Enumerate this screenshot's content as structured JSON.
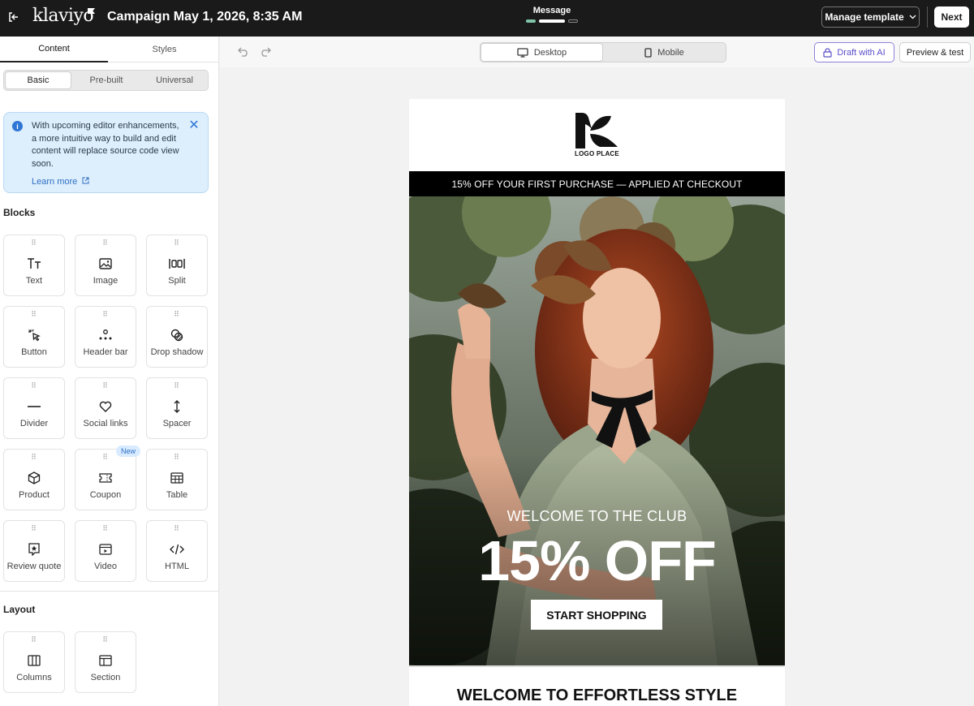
{
  "header": {
    "brand": "klaviyo",
    "campaign_title": "Campaign May 1, 2026, 8:35 AM",
    "step_label": "Message",
    "manage_template_label": "Manage template",
    "next_label": "Next"
  },
  "sidebar": {
    "tabs": [
      "Content",
      "Styles"
    ],
    "segments": [
      "Basic",
      "Pre-built",
      "Universal"
    ],
    "notice": {
      "text": "With upcoming editor enhancements, a more intuitive way to build and edit content will replace source code view soon.",
      "link": "Learn more"
    },
    "blocks_heading": "Blocks",
    "blocks": [
      {
        "label": "Text",
        "icon": "text-icon"
      },
      {
        "label": "Image",
        "icon": "image-icon"
      },
      {
        "label": "Split",
        "icon": "split-icon"
      },
      {
        "label": "Button",
        "icon": "button-cursor-icon"
      },
      {
        "label": "Header bar",
        "icon": "header-bar-icon"
      },
      {
        "label": "Drop shadow",
        "icon": "drop-shadow-icon"
      },
      {
        "label": "Divider",
        "icon": "divider-icon"
      },
      {
        "label": "Social links",
        "icon": "heart-icon"
      },
      {
        "label": "Spacer",
        "icon": "spacer-icon"
      },
      {
        "label": "Product",
        "icon": "cube-icon"
      },
      {
        "label": "Coupon",
        "icon": "coupon-icon"
      },
      {
        "label": "Table",
        "icon": "table-icon"
      },
      {
        "label": "Review quote",
        "icon": "star-icon"
      },
      {
        "label": "Video",
        "icon": "video-icon"
      },
      {
        "label": "HTML",
        "icon": "code-icon"
      }
    ],
    "new_badge": "New",
    "layout_heading": "Layout",
    "layout_blocks": [
      {
        "label": "Columns",
        "icon": "columns-icon"
      },
      {
        "label": "Section",
        "icon": "section-icon"
      }
    ]
  },
  "toolbar": {
    "desktop_label": "Desktop",
    "mobile_label": "Mobile",
    "draft_ai_label": "Draft with AI",
    "preview_label": "Preview & test"
  },
  "email": {
    "logo_caption": "LOGO PLACE",
    "promo_bar": "15% OFF YOUR FIRST PURCHASE — APPLIED AT CHECKOUT",
    "hero_kicker": "WELCOME TO THE CLUB",
    "hero_headline": "15% OFF",
    "hero_cta": "START SHOPPING",
    "section_heading": "WELCOME TO EFFORTLESS STYLE"
  },
  "colors": {
    "topbar": "#1a1a1a",
    "info_bg": "#ddeefc",
    "ai_accent": "#5a4fc8",
    "step_active": "#ffffff",
    "step_done": "#7fc3a8"
  }
}
